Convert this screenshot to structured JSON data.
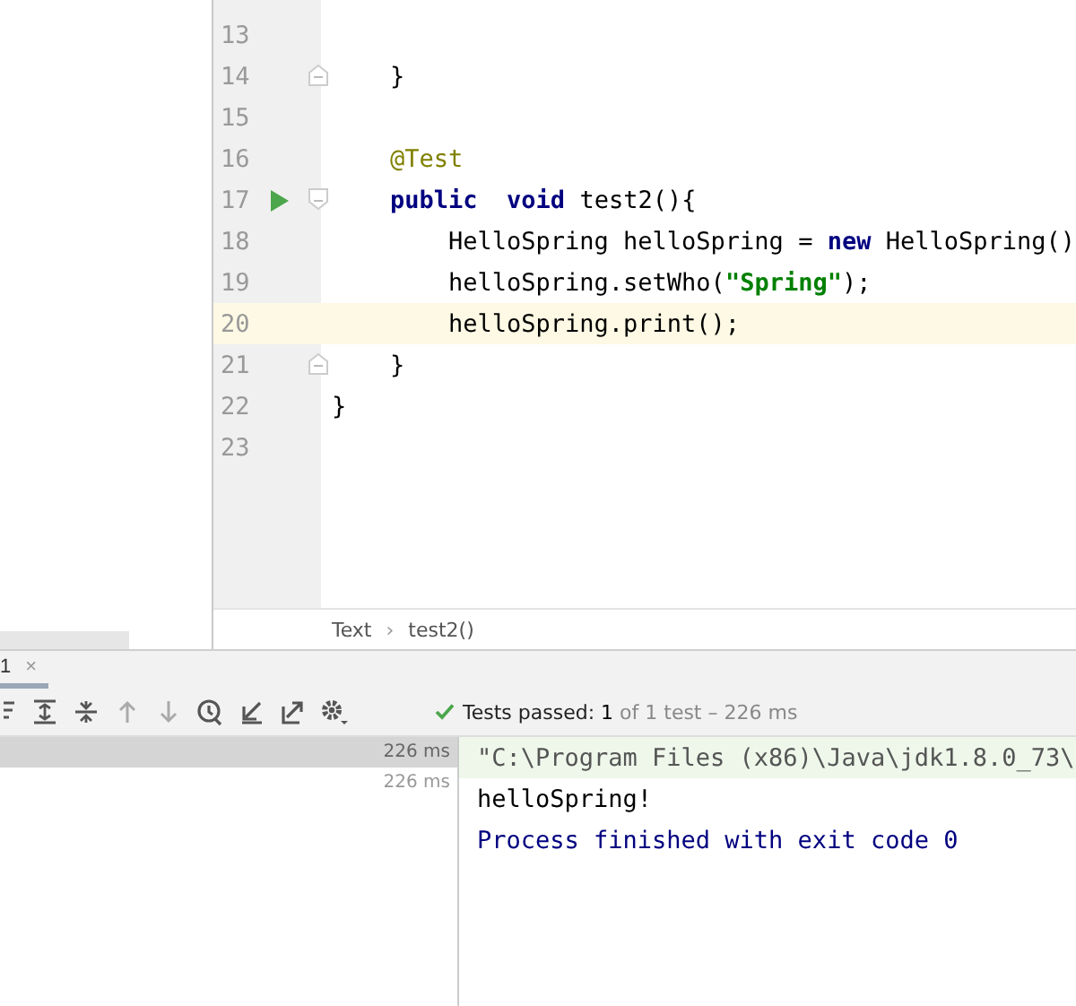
{
  "editor": {
    "lines": [
      {
        "number": "13",
        "current": false,
        "fold_marker": false,
        "run_button": false
      },
      {
        "number": "14",
        "kind": "member",
        "tokens": [
          {
            "kind": "plain",
            "text": "}"
          }
        ],
        "current": false,
        "fold_marker": true,
        "run_button": false
      },
      {
        "number": "15",
        "current": false,
        "fold_marker": false,
        "run_button": false
      },
      {
        "number": "16",
        "kind": "member",
        "tokens": [
          {
            "kind": "annotation",
            "text": "@Test"
          }
        ],
        "current": false,
        "fold_marker": false,
        "run_button": false
      },
      {
        "number": "17",
        "kind": "member",
        "tokens": [
          {
            "kind": "keyword",
            "text": "public"
          },
          {
            "kind": "keyword",
            "text": "  void"
          },
          {
            "kind": "plain",
            "text": " test2(){"
          }
        ],
        "current": false,
        "fold_marker": true,
        "run_button": true
      },
      {
        "number": "18",
        "kind": "statement",
        "tokens": [
          {
            "kind": "plain",
            "text": "HelloSpring helloSpring = "
          },
          {
            "kind": "keyword",
            "text": "new"
          },
          {
            "kind": "plain",
            "text": " HelloSpring()"
          }
        ],
        "current": false,
        "fold_marker": false,
        "run_button": false
      },
      {
        "number": "19",
        "kind": "statement",
        "tokens": [
          {
            "kind": "plain",
            "text": "helloSpring.setWho("
          },
          {
            "kind": "string",
            "text": "\"Spring\""
          },
          {
            "kind": "plain",
            "text": ");"
          }
        ],
        "current": false,
        "fold_marker": false,
        "run_button": false
      },
      {
        "number": "20",
        "kind": "statement",
        "tokens": [
          {
            "kind": "plain",
            "text": "helloSpring.print();"
          }
        ],
        "current": true,
        "fold_marker": false,
        "run_button": false
      },
      {
        "number": "21",
        "kind": "member",
        "tokens": [
          {
            "kind": "plain",
            "text": "}"
          }
        ],
        "current": false,
        "fold_marker": true,
        "run_button": false
      },
      {
        "number": "22",
        "kind": "class",
        "tokens": [
          {
            "kind": "plain",
            "text": "}"
          }
        ],
        "current": false,
        "fold_marker": false,
        "run_button": false
      },
      {
        "number": "23",
        "current": false,
        "fold_marker": false,
        "run_button": false
      }
    ],
    "breadcrumbs": [
      "Text",
      "test2()"
    ],
    "breadcrumb_separator": "›"
  },
  "run_panel": {
    "tab": {
      "label": "1",
      "close": "×",
      "selected": true
    },
    "toolbar": [
      {
        "kind": "sort"
      },
      {
        "kind": "expand"
      },
      {
        "kind": "collapse"
      },
      {
        "kind": "up",
        "disabled": true
      },
      {
        "kind": "down",
        "disabled": true
      },
      {
        "kind": "history",
        "disabled": false
      },
      {
        "kind": "import",
        "disabled": false
      },
      {
        "kind": "export",
        "disabled": false
      },
      {
        "kind": "settings",
        "disabled": false
      }
    ],
    "status": {
      "label": "Tests passed:",
      "count": "1",
      "rest": "of 1 test – 226 ms"
    },
    "tree": [
      {
        "time": "226 ms",
        "selected": true
      },
      {
        "time": "226 ms",
        "selected": false
      }
    ],
    "console": [
      {
        "kind": "command",
        "text": "\"C:\\Program Files (x86)\\Java\\jdk1.8.0_73\\"
      },
      {
        "kind": "output",
        "text": "helloSpring!"
      },
      {
        "kind": "system",
        "text": "Process finished with exit code 0"
      }
    ]
  }
}
